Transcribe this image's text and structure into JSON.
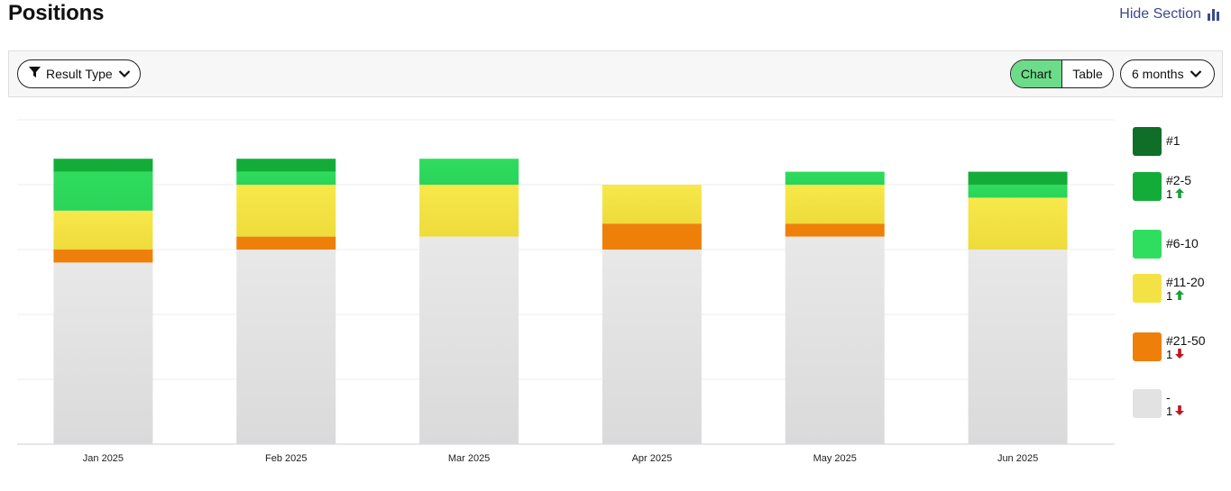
{
  "header": {
    "title": "Positions",
    "hide_label": "Hide Section"
  },
  "toolbar": {
    "filter_label": "Result Type",
    "view_chart_label": "Chart",
    "view_table_label": "Table",
    "period_label": "6 months",
    "active_view": "Chart"
  },
  "icons": {
    "filter": "filter-icon",
    "chevron": "chevron-down-icon",
    "bar_chart": "bar-chart-icon",
    "arrow_up": "arrow-up-icon",
    "arrow_down": "arrow-down-icon"
  },
  "colors": {
    "pos_1": "#0f6e27",
    "pos_2_5": "#14ac39",
    "pos_6_10": "#30de5f",
    "pos_11_20": "#f4e244",
    "pos_21_50": "#ee800a",
    "none": "#e2e2e2",
    "up": "#1a9e3a",
    "down": "#c0161b",
    "toggle_active": "#6ddc8a",
    "link": "#3c4a8e"
  },
  "chart_data": {
    "type": "bar",
    "stacked": true,
    "categories": [
      "Jan 2025",
      "Feb 2025",
      "Mar 2025",
      "Apr 2025",
      "May 2025",
      "Jun 2025"
    ],
    "series": [
      {
        "name": "-",
        "values": [
          14,
          15,
          16,
          15,
          16,
          15
        ]
      },
      {
        "name": "#21-50",
        "values": [
          1,
          1,
          0,
          2,
          1,
          0
        ]
      },
      {
        "name": "#11-20",
        "values": [
          3,
          4,
          4,
          3,
          3,
          4
        ]
      },
      {
        "name": "#6-10",
        "values": [
          3,
          1,
          2,
          0,
          1,
          1
        ]
      },
      {
        "name": "#2-5",
        "values": [
          1,
          1,
          0,
          0,
          0,
          1
        ]
      },
      {
        "name": "#1",
        "values": [
          0,
          0,
          0,
          0,
          0,
          0
        ]
      }
    ],
    "ylim": [
      0,
      25
    ],
    "grid": true,
    "legend_position": "right"
  },
  "legend": {
    "items": [
      {
        "label": "#1",
        "delta": "",
        "direction": ""
      },
      {
        "label": "#2-5",
        "delta": "1",
        "direction": "up"
      },
      {
        "label": "#6-10",
        "delta": "",
        "direction": ""
      },
      {
        "label": "#11-20",
        "delta": "1",
        "direction": "up"
      },
      {
        "label": "#21-50",
        "delta": "1",
        "direction": "down"
      },
      {
        "label": "-",
        "delta": "1",
        "direction": "down"
      }
    ]
  }
}
